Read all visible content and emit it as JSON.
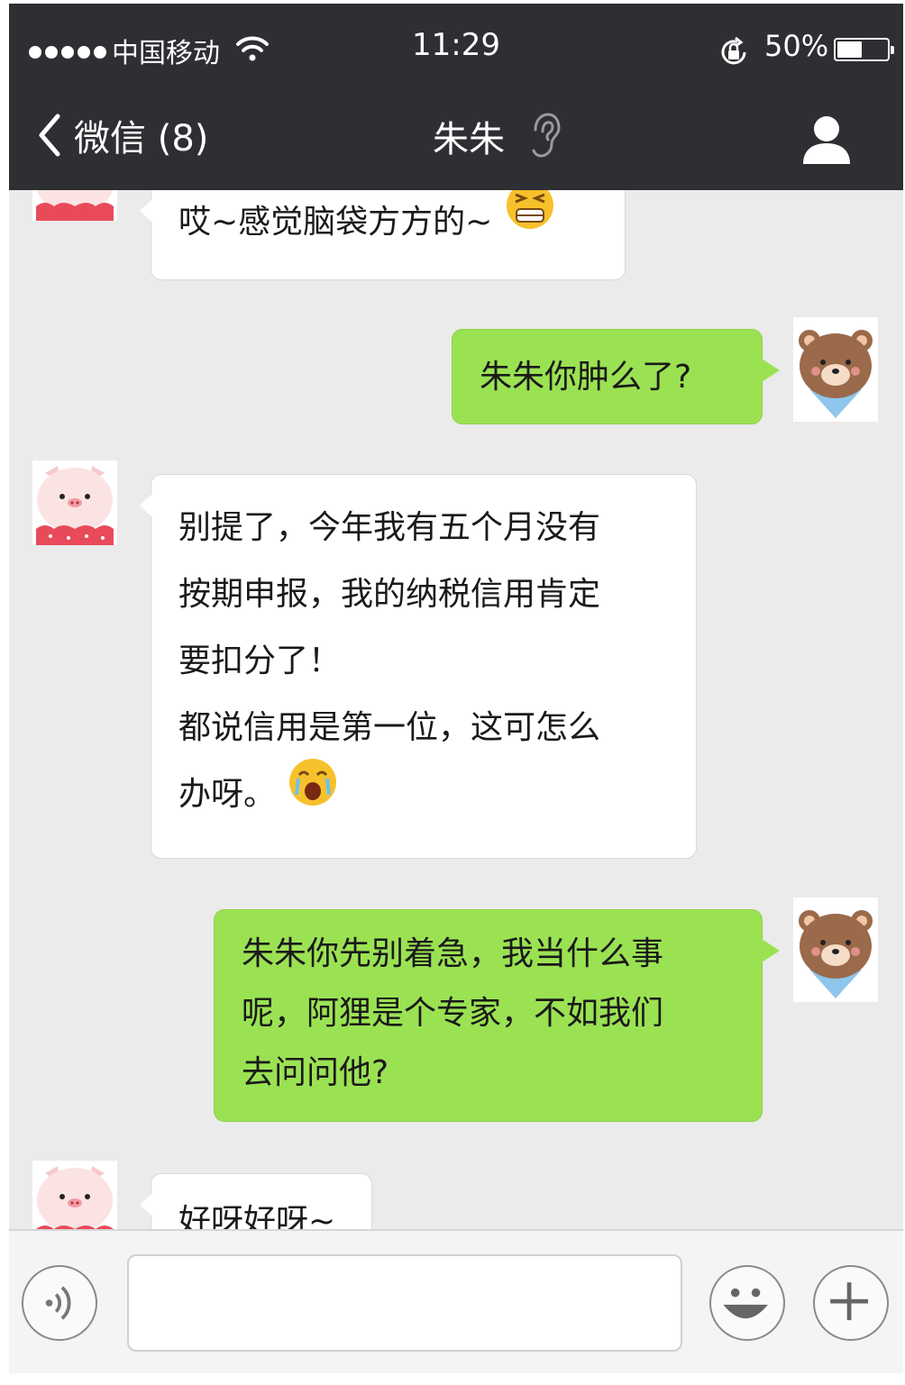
{
  "status_bar": {
    "carrier": "中国移动",
    "time": "11:29",
    "battery": "50%",
    "battery_level": 0.5,
    "signal_dots": 5
  },
  "nav": {
    "back_label": "微信 (8)",
    "title": "朱朱"
  },
  "messages": [
    {
      "side": "left",
      "avatar": "pig",
      "text": "哎~感觉脑袋方方的~",
      "emoji": "grimacing-emoji"
    },
    {
      "side": "right",
      "avatar": "bear",
      "text": "朱朱你肿么了?"
    },
    {
      "side": "left",
      "avatar": "pig",
      "lines": [
        "别提了，今年我有五个月没有",
        "按期申报，我的纳税信用肯定",
        "要扣分了！",
        "都说信用是第一位，这可怎么",
        "办呀。"
      ],
      "emoji": "crying-emoji"
    },
    {
      "side": "right",
      "avatar": "bear",
      "lines": [
        "朱朱你先别着急，我当什么事",
        "呢，阿狸是个专家，不如我们",
        "去问问他?"
      ]
    },
    {
      "side": "left",
      "avatar": "pig",
      "text": "好呀好呀~"
    }
  ],
  "input": {
    "value": ""
  },
  "colors": {
    "topbar": "#2e2f33",
    "chat_bg": "#ebebeb",
    "bubble_right": "#9be253",
    "bubble_left": "#ffffff"
  }
}
